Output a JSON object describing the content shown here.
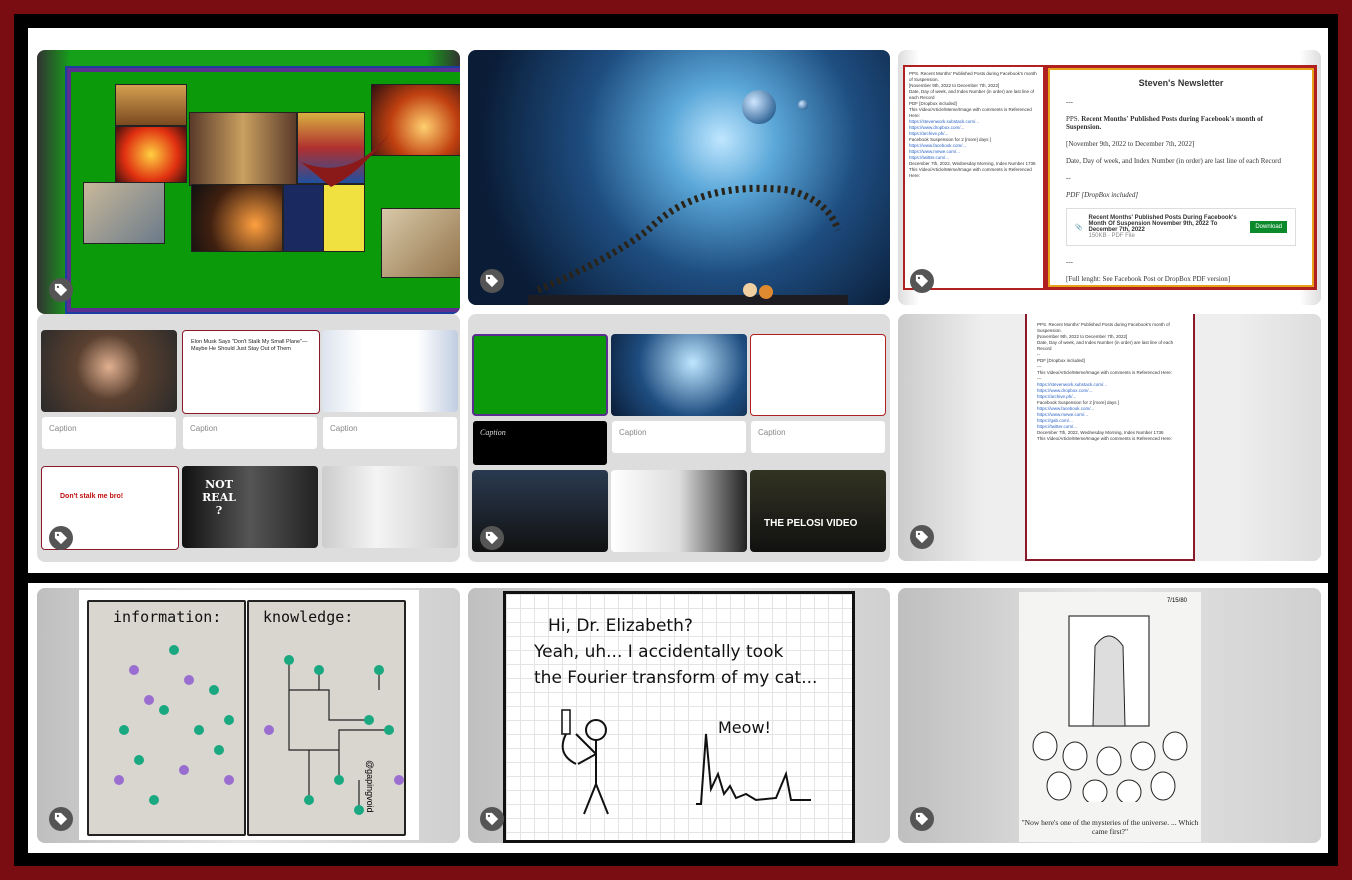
{
  "newsletter": {
    "title": "Steven's Newsletter",
    "sep1": "---",
    "heading_prefix": "PPS. ",
    "heading": "Recent Months' Published Posts during Facebook's month of Suspension.",
    "dates": "[November 9th, 2022 to December 7th, 2022]",
    "note": "Date, Day of week, and Index Number (in order) are last line of each Record",
    "sep2": "--",
    "pdf_label": "PDF [DropBox included]",
    "pdf_title": "Recent Months' Published Posts During Facebook's Month Of Suspension November 9th, 2022 To December 7th, 2022",
    "pdf_meta": "150KB ∙ PDF File",
    "download": "Download",
    "sep3": "---",
    "footer": "[Full lenght: See Facebook Post or DropBox PDF version]"
  },
  "doc_lines": [
    "PPS. Recent Months' Published Posts during Facebook's month of Suspension.",
    "[November 9th, 2022 to December 7th, 2022]",
    "Date, Day of week, and Index Number (in order) are last line of each Record",
    "--",
    "PDF [Dropbox included]",
    "---",
    "This Video/Article/Meme/Image with comments is Referenced Here:",
    "---",
    "Facebook Suspension for 2 [more] days ]",
    "December 7th, 2022, Wednesday Morning, Index Number 1736",
    "This Video/Article/Meme/Image with comments is Referenced Here:"
  ],
  "gallery1": {
    "captions": [
      "Caption",
      "Caption",
      "Caption"
    ],
    "thumb_titles": [
      "Elon Musk Says \"Don't Stalk My Small Plane\"—Maybe He Should Just Stay Out of Them",
      "Don't stalk me bro!",
      "NOT REAL ?"
    ]
  },
  "gallery2": {
    "captions": [
      "Caption",
      "Caption",
      "Caption"
    ],
    "banner": "THE PELOSI VIDEO"
  },
  "comics": {
    "info_left": "information:",
    "info_right": "knowledge:",
    "info_credit": "@gapingvoid",
    "xkcd_lines": [
      "Hi, Dr. Elizabeth?",
      "Yeah, uh... I accidentally took",
      "the Fourier transform of my cat..."
    ],
    "xkcd_meow": "Meow!",
    "far_date": "7/15/80",
    "far_caption": "\"Now here's one of the mysteries of the universe. ... Which came first?\""
  },
  "colors": {
    "page_border": "#7a0d12",
    "collage_green": "#0a9a0a",
    "doc_border": "#8a1a2a",
    "link_blue": "#2a63c7"
  },
  "icons": {
    "tag": "tag-icon"
  }
}
